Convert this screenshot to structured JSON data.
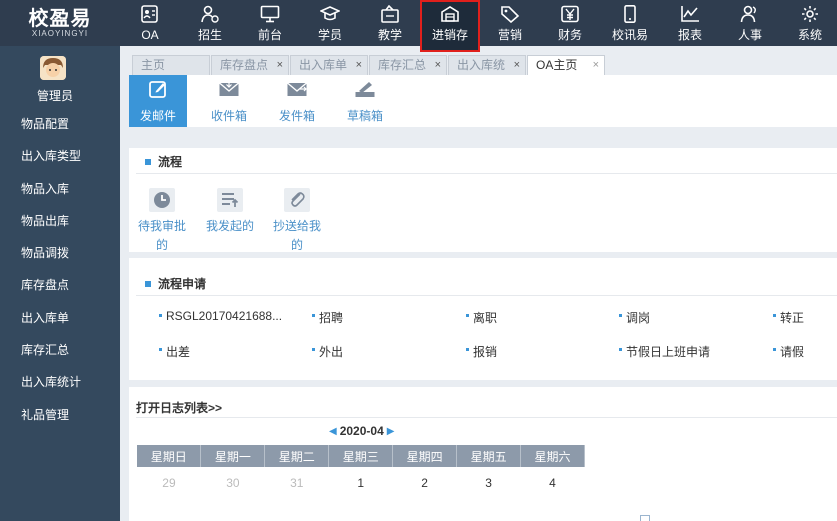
{
  "brand": {
    "name_cn": "校盈易",
    "name_en": "XIAOYINGYI"
  },
  "nav": [
    {
      "label": "OA",
      "icon": "id-card-icon"
    },
    {
      "label": "招生",
      "icon": "person-add-icon"
    },
    {
      "label": "前台",
      "icon": "monitor-icon"
    },
    {
      "label": "学员",
      "icon": "graduation-cap-icon"
    },
    {
      "label": "教学",
      "icon": "teaching-bag-icon"
    },
    {
      "label": "进销存",
      "icon": "warehouse-icon"
    },
    {
      "label": "营销",
      "icon": "tag-icon"
    },
    {
      "label": "财务",
      "icon": "yen-icon"
    },
    {
      "label": "校讯易",
      "icon": "mobile-icon"
    },
    {
      "label": "报表",
      "icon": "line-chart-icon"
    },
    {
      "label": "人事",
      "icon": "people-icon"
    },
    {
      "label": "系统",
      "icon": "gear-icon"
    }
  ],
  "user": {
    "name": "管理员"
  },
  "sidebar": [
    "物品配置",
    "出入库类型",
    "物品入库",
    "物品出库",
    "物品调拨",
    "库存盘点",
    "出入库单",
    "库存汇总",
    "出入库统计",
    "礼品管理"
  ],
  "tabs": [
    {
      "label": "主页",
      "closable": false
    },
    {
      "label": "库存盘点",
      "closable": true
    },
    {
      "label": "出入库单",
      "closable": true
    },
    {
      "label": "库存汇总",
      "closable": true
    },
    {
      "label": "出入库统",
      "closable": true
    },
    {
      "label": "OA主页",
      "closable": true
    }
  ],
  "mail": [
    {
      "label": "发邮件",
      "icon": "compose-icon"
    },
    {
      "label": "收件箱",
      "icon": "inbox-icon"
    },
    {
      "label": "发件箱",
      "icon": "outbox-icon"
    },
    {
      "label": "草稿箱",
      "icon": "draft-icon"
    }
  ],
  "flow": {
    "title": "流程",
    "items": [
      {
        "label": "待我审批的",
        "icon": "clock-icon"
      },
      {
        "label": "我发起的",
        "icon": "list-up-icon"
      },
      {
        "label": "抄送给我的",
        "icon": "paperclip-icon"
      }
    ]
  },
  "apply": {
    "title": "流程申请",
    "items": [
      "RSGL20170421688...",
      "招聘",
      "离职",
      "调岗",
      "转正",
      "出差",
      "外出",
      "报销",
      "节假日上班申请",
      "请假"
    ]
  },
  "log": {
    "link": "打开日志列表>>"
  },
  "calendar": {
    "month": "2020-04",
    "weekdays": [
      "星期日",
      "星期一",
      "星期二",
      "星期三",
      "星期四",
      "星期五",
      "星期六"
    ],
    "row1": [
      "29",
      "30",
      "31",
      "1",
      "2",
      "3",
      "4"
    ]
  },
  "colors": {
    "accent": "#3a95d8",
    "topbar": "#2f3d4f",
    "sidebar": "#34495e",
    "highlight": "#e0201c"
  }
}
